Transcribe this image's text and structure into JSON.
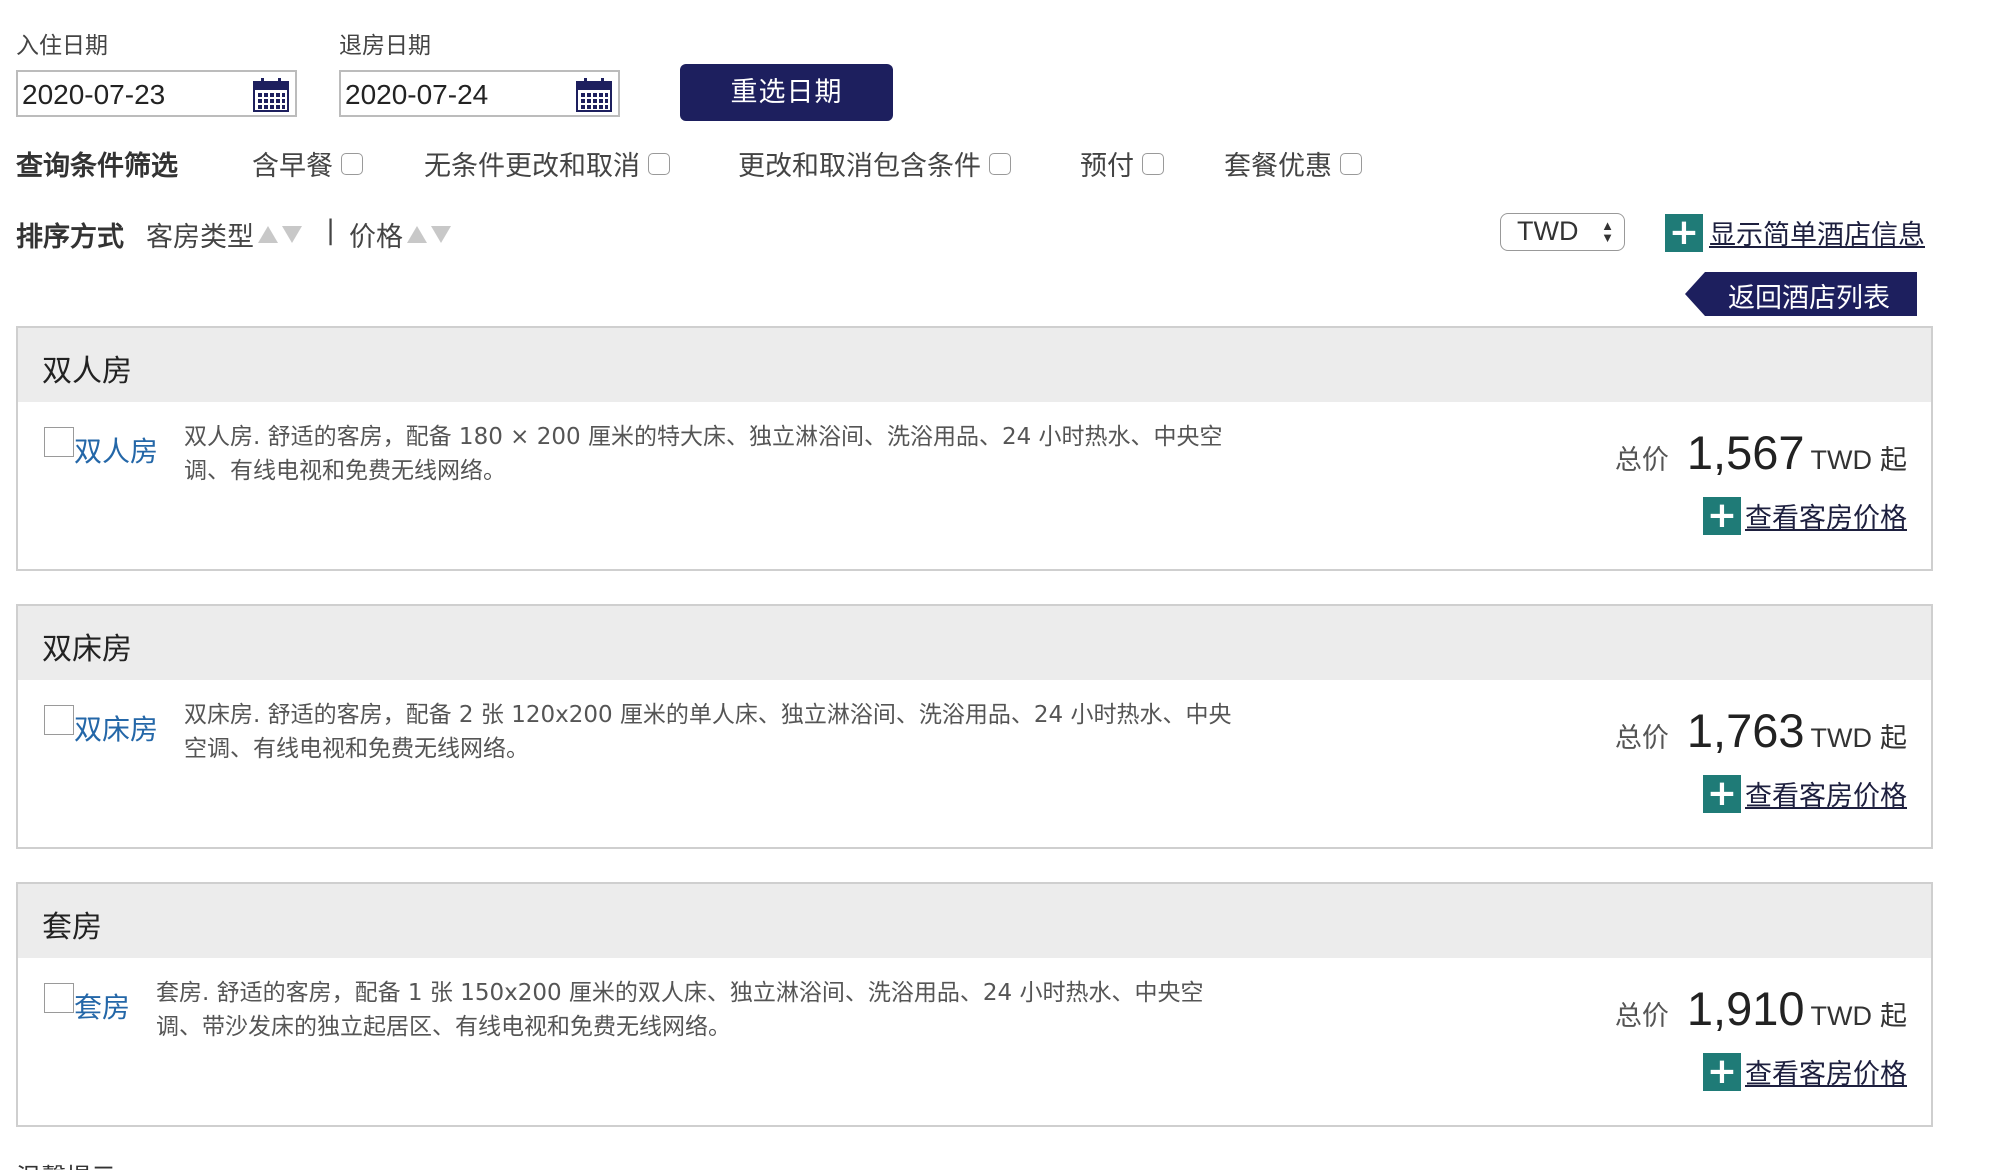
{
  "dates": {
    "checkin_label": "入住日期",
    "checkin_value": "2020-07-23",
    "checkout_label": "退房日期",
    "checkout_value": "2020-07-24",
    "reselect_label": "重选日期"
  },
  "filters": {
    "title": "查询条件筛选",
    "options": [
      "含早餐",
      "无条件更改和取消",
      "更改和取消包含条件",
      "预付",
      "套餐优惠"
    ]
  },
  "sort": {
    "title": "排序方式",
    "room_type_label": "客房类型",
    "separator": "|",
    "price_label": "价格"
  },
  "currency": {
    "selected": "TWD"
  },
  "hotel_info_link": "显示简单酒店信息",
  "back_label": "返回酒店列表",
  "rooms": [
    {
      "header": "双人房",
      "name": "双人房",
      "desc_line1": "双人房. 舒适的客房，配备 180 × 200 厘米的特大床、独立淋浴间、洗浴用品、24 小时热水、中央空",
      "desc_line2": "调、有线电视和免费无线网络。",
      "price_label": "总价",
      "price": "1,567",
      "currency": "TWD",
      "from": "起",
      "view_label": "查看客房价格"
    },
    {
      "header": "双床房",
      "name": "双床房",
      "desc_line1": "双床房. 舒适的客房，配备 2 张 120x200 厘米的单人床、独立淋浴间、洗浴用品、24 小时热水、中央",
      "desc_line2": "空调、有线电视和免费无线网络。",
      "price_label": "总价",
      "price": "1,763",
      "currency": "TWD",
      "from": "起",
      "view_label": "查看客房价格"
    },
    {
      "header": "套房",
      "name": "套房",
      "desc_line1": "套房. 舒适的客房，配备 1 张 150x200 厘米的双人床、独立淋浴间、洗浴用品、24 小时热水、中央空",
      "desc_line2": "调、带沙发床的独立起居区、有线电视和免费无线网络。",
      "price_label": "总价",
      "price": "1,910",
      "currency": "TWD",
      "from": "起",
      "view_label": "查看客房价格"
    }
  ],
  "tips_label": "温馨提示",
  "colors": {
    "primary_navy": "#1d1f5e",
    "teal_plus": "#1f7b77",
    "link_blue": "#2467a8",
    "card_header_bg": "#ececec"
  }
}
